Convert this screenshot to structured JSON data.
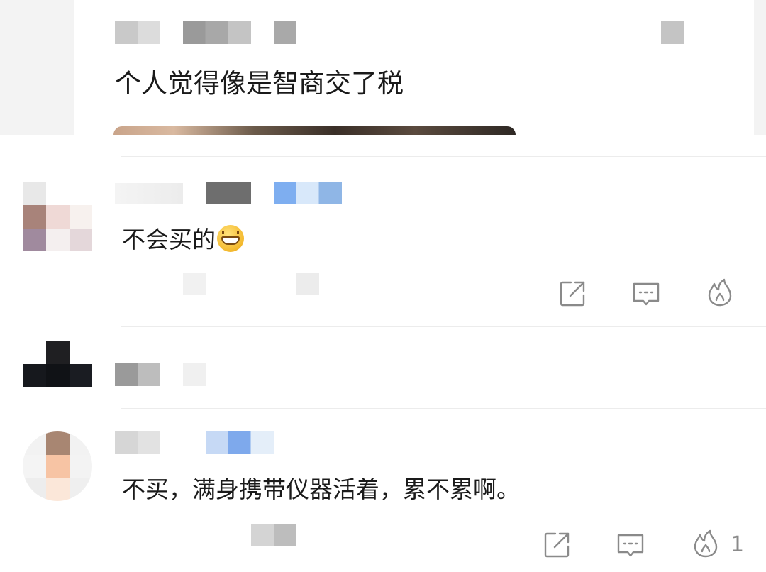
{
  "quoted_comment": {
    "text": "个人觉得像是智商交了税"
  },
  "comments": [
    {
      "text": "不会买的",
      "emoji": "grinning-face-emoji",
      "actions": [
        "share-icon",
        "reply-icon",
        "fire-like-icon"
      ]
    },
    {
      "text": ""
    },
    {
      "text": "不买，满身携带仪器活着，累不累啊。",
      "actions": [
        "share-icon",
        "reply-icon",
        "fire-like-icon"
      ],
      "like_count": "1"
    }
  ],
  "colors": {
    "text": "#1a1a1a",
    "icon": "#8a8a8a",
    "separator": "#ececec",
    "blur_grey": "#b8b8b8",
    "blur_blue": "#8fb6ec"
  }
}
